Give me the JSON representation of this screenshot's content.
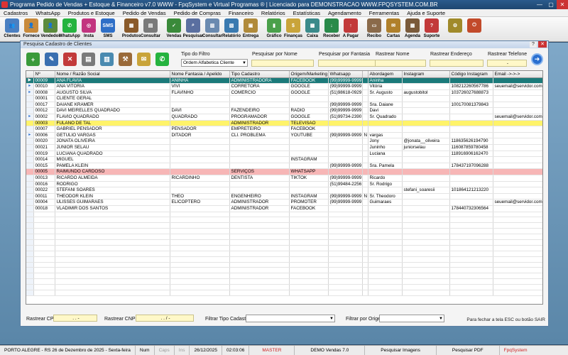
{
  "app": {
    "title": "Programa Pedido de Vendas + Estoque & Financeiro v7.0 WWW - FpqSystem e Virtual Programas ® | Licenciado para  DEMONSTRACAO WWW.FPQSYSTEM.COM.BR",
    "minimize": "—",
    "maximize": "▢",
    "close": "✕"
  },
  "menu": [
    "Cadastros",
    "WhatsApp",
    "Produtos e Estoque",
    "Pedido de Vendas",
    "Pedido de Compras",
    "Financeiro",
    "Relatórios",
    "Estatísticas",
    "Agendamento",
    "Ferramentas",
    "Ajuda e Suporte"
  ],
  "toolbar": [
    {
      "label": "Clientes",
      "icon": "clients-icon",
      "color": "#4a7fc1",
      "glyph": "👥"
    },
    {
      "label": "Fornece",
      "icon": "supplier-icon",
      "color": "#c98a3a",
      "glyph": "👤"
    },
    {
      "label": "Vendedor",
      "icon": "seller-icon",
      "color": "#5b8a3c",
      "glyph": "👤"
    },
    {
      "label": "WhatsApp",
      "icon": "whatsapp-icon",
      "color": "#25b33f",
      "glyph": "✆"
    },
    {
      "label": "Insta",
      "icon": "instagram-icon",
      "color": "#c2357f",
      "glyph": "◎"
    },
    {
      "label": "SMS",
      "icon": "sms-icon",
      "color": "#2f6fc7",
      "glyph": "SMS"
    },
    {
      "label": "Produtos",
      "icon": "products-icon",
      "color": "#8a5a2a",
      "glyph": "▦"
    },
    {
      "label": "Consultar",
      "icon": "consult-icon",
      "color": "#7a7a7a",
      "glyph": "▤"
    },
    {
      "label": "Vendas",
      "icon": "sales-icon",
      "color": "#3a8a3a",
      "glyph": "✓"
    },
    {
      "label": "Pesquisar",
      "icon": "search-icon",
      "color": "#5a6fa0",
      "glyph": "⌕"
    },
    {
      "label": "Consultar",
      "icon": "consult-doc-icon",
      "color": "#6a8ab0",
      "glyph": "▥"
    },
    {
      "label": "Relatório",
      "icon": "report-icon",
      "color": "#3a7ab0",
      "glyph": "▧"
    },
    {
      "label": "Entrega",
      "icon": "delivery-icon",
      "color": "#b08a3a",
      "glyph": "▣"
    },
    {
      "label": "Gráfico",
      "icon": "chart-icon",
      "color": "#4aa04a",
      "glyph": "▮"
    },
    {
      "label": "Finanças",
      "icon": "finance-icon",
      "color": "#c9a43a",
      "glyph": "$"
    },
    {
      "label": "Caixa",
      "icon": "cashbox-icon",
      "color": "#3a8a8a",
      "glyph": "▩"
    },
    {
      "label": "Receber",
      "icon": "receive-icon",
      "color": "#2a8a4a",
      "glyph": "↓"
    },
    {
      "label": "A Pagar",
      "icon": "pay-icon",
      "color": "#c23a3a",
      "glyph": "↑"
    },
    {
      "label": "Recibo",
      "icon": "receipt-icon",
      "color": "#8a6a4a",
      "glyph": "▭"
    },
    {
      "label": "Cartas",
      "icon": "letters-icon",
      "color": "#b0802a",
      "glyph": "✉"
    },
    {
      "label": "Agenda",
      "icon": "calendar-icon",
      "color": "#7a5a3a",
      "glyph": "▦"
    },
    {
      "label": "Suporte",
      "icon": "support-icon",
      "color": "#c23a3a",
      "glyph": "?"
    },
    {
      "label": "",
      "icon": "settings-icon",
      "color": "#a08a2a",
      "glyph": "⚙"
    },
    {
      "label": "",
      "icon": "exit-icon",
      "color": "#c24a2a",
      "glyph": "⏻"
    }
  ],
  "dialog": {
    "title": "Pesquisa Cadastro de Clientes",
    "help": "?",
    "close": "✕",
    "tools": [
      {
        "icon": "add-icon",
        "color": "#3a9a3a",
        "glyph": "+"
      },
      {
        "icon": "edit-icon",
        "color": "#3a6fb0",
        "glyph": "✎"
      },
      {
        "icon": "delete-icon",
        "color": "#c23a3a",
        "glyph": "✕"
      },
      {
        "icon": "print-icon",
        "color": "#7a7a7a",
        "glyph": "▤"
      },
      {
        "icon": "export-icon",
        "color": "#4a8ab0",
        "glyph": "▥"
      },
      {
        "icon": "tools-icon",
        "color": "#9a6a3a",
        "glyph": "⚒"
      },
      {
        "icon": "email-icon",
        "color": "#c9a43a",
        "glyph": "✉"
      },
      {
        "icon": "whatsapp-send-icon",
        "color": "#25b33f",
        "glyph": "✆"
      }
    ],
    "filters": {
      "tipo_filtro_label": "Tipo do Filtro",
      "tipo_filtro_value": "Ordem Alfabetica Cliente",
      "nome_label": "Pesquisar por Nome",
      "fantasia_label": "Pesquisar por Fantasia",
      "rastrear_nome_label": "Rastrear Nome",
      "rastrear_endereco_label": "Rastrear Endereço",
      "rastrear_telefone_label": "Rastrear Telefone",
      "rastrear_telefone_value": "-",
      "go": "➜"
    },
    "columns": [
      "Nº",
      "Nome / Razão Social",
      "Nome Fantasia / Apelido",
      "Tipo Cadastro",
      "Origem/Marketing",
      "Whatsapp",
      "",
      "Abordagem",
      "Instagram",
      "Código Instagram",
      "Email ->->->"
    ],
    "rows": [
      {
        "n": "00009",
        "nome": "ANA FLAVIA",
        "fantasia": "ANINHA",
        "tipo": "ADMINISTRADORA",
        "origem": "FACEBOOK",
        "whats": "(99)99999-9999",
        "f": "",
        "abord": "Aninha",
        "insta": "",
        "cod": "",
        "email": "",
        "style": "sel",
        "ind": "▶"
      },
      {
        "n": "00010",
        "nome": "ANA VITORIA",
        "fantasia": "VIVI",
        "tipo": "CORRETORA",
        "origem": "GOOGLE",
        "whats": "(99)99999-9999",
        "f": "",
        "abord": "Vitória",
        "insta": "",
        "cod": "108212260567786",
        "email": "seuemail@servidor.com.br",
        "style": "",
        "ind": "▸"
      },
      {
        "n": "00008",
        "nome": "AUGUSTO SILVA",
        "fantasia": "FLAVINHO",
        "tipo": "COMERCIO",
        "origem": "GOOGLE",
        "whats": "(51)98618-0929",
        "f": "",
        "abord": "Sr. Augusto",
        "insta": "augustobitol",
        "cod": "103726027688873",
        "email": "",
        "style": "",
        "ind": "▸"
      },
      {
        "n": "00001",
        "nome": "CLIENTE GERAL",
        "fantasia": "",
        "tipo": "",
        "origem": "",
        "whats": "",
        "f": "",
        "abord": "",
        "insta": "",
        "cod": "",
        "email": "",
        "style": "",
        "ind": ""
      },
      {
        "n": "00017",
        "nome": "DAIANE KRAMER",
        "fantasia": "",
        "tipo": "",
        "origem": "",
        "whats": "(99)99999-9999",
        "f": "",
        "abord": "Sra. Daiane",
        "insta": "",
        "cod": "100170081379843",
        "email": "",
        "style": "",
        "ind": ""
      },
      {
        "n": "00012",
        "nome": "DAVI MEIRELLES QUADRADO",
        "fantasia": "DAVI",
        "tipo": "FAZENDEIRO",
        "origem": "RADIO",
        "whats": "(99)99999-9999",
        "f": "",
        "abord": "Davi",
        "insta": "",
        "cod": "",
        "email": "",
        "style": "",
        "ind": ""
      },
      {
        "n": "00002",
        "nome": "FLAVIO QUADRADO",
        "fantasia": "QUADRADO",
        "tipo": "PROGRAMADOR",
        "origem": "GOOGLE",
        "whats": "(51)99734-2390",
        "f": "",
        "abord": "Sr. Quadrado",
        "insta": "",
        "cod": "",
        "email": "seuemail@servidor.com.br",
        "style": "",
        "ind": "▸"
      },
      {
        "n": "00003",
        "nome": "FULANO DE TAL",
        "fantasia": "",
        "tipo": "ADMINISTRADOR",
        "origem": "TELEVISÃO",
        "whats": "",
        "f": "",
        "abord": "",
        "insta": "",
        "cod": "",
        "email": "",
        "style": "yellow",
        "ind": ""
      },
      {
        "n": "00007",
        "nome": "GABRIEL PENSADOR",
        "fantasia": "PENSADOR",
        "tipo": "EMPRETEIRO",
        "origem": "FACEBOOK",
        "whats": "",
        "f": "",
        "abord": "",
        "insta": "",
        "cod": "",
        "email": "",
        "style": "",
        "ind": ""
      },
      {
        "n": "00006",
        "nome": "GETULIO VARGAS",
        "fantasia": "DITADOR",
        "tipo": "CLI. PROBLEMA",
        "origem": "YOUTUBE",
        "whats": "(99)99999-9999",
        "f": "N",
        "abord": "vargas",
        "insta": "",
        "cod": "",
        "email": "",
        "style": "",
        "ind": "▸"
      },
      {
        "n": "00020",
        "nome": "JONATA OLIVEIRA",
        "fantasia": "",
        "tipo": "",
        "origem": "",
        "whats": "",
        "f": "",
        "abord": "Jony",
        "insta": "@jonata__oliveira",
        "cod": "118635626194790",
        "email": "",
        "style": "",
        "ind": ""
      },
      {
        "n": "00021",
        "nome": "JUNIOR SELAU",
        "fantasia": "",
        "tipo": "",
        "origem": "",
        "whats": "",
        "f": "",
        "abord": "Juninho",
        "insta": "juniorselau",
        "cod": "116087859780458",
        "email": "",
        "style": "",
        "ind": ""
      },
      {
        "n": "00019",
        "nome": "LUCIANA QUADRADO",
        "fantasia": "",
        "tipo": "",
        "origem": "",
        "whats": "",
        "f": "",
        "abord": "Luciana",
        "insta": "",
        "cod": "118916906162470",
        "email": "",
        "style": "",
        "ind": ""
      },
      {
        "n": "00014",
        "nome": "MIGUEL",
        "fantasia": "",
        "tipo": "",
        "origem": "INSTAGRAM",
        "whats": "",
        "f": "",
        "abord": "",
        "insta": "",
        "cod": "",
        "email": "",
        "style": "",
        "ind": ""
      },
      {
        "n": "00015",
        "nome": "PAMELA KLEIN",
        "fantasia": "",
        "tipo": "",
        "origem": "",
        "whats": "(99)99999-9999",
        "f": "",
        "abord": "Sra. Pamela",
        "insta": "",
        "cod": "178437197096288",
        "email": "",
        "style": "",
        "ind": ""
      },
      {
        "n": "00005",
        "nome": "RAIMUNDO CARDOSO",
        "fantasia": "",
        "tipo": "SERVIÇOS",
        "origem": "WHATSAPP",
        "whats": "",
        "f": "",
        "abord": "",
        "insta": "",
        "cod": "",
        "email": "",
        "style": "pink",
        "ind": ""
      },
      {
        "n": "00013",
        "nome": "RICARDO ALMEIDA",
        "fantasia": "RICARDINHO",
        "tipo": "DENTISTA",
        "origem": "TIKTOK",
        "whats": "(99)99999-9999",
        "f": "",
        "abord": "Ricardo",
        "insta": "",
        "cod": "",
        "email": "",
        "style": "",
        "ind": ""
      },
      {
        "n": "00016",
        "nome": "RODRIGO",
        "fantasia": "",
        "tipo": "",
        "origem": "",
        "whats": "(51)99484-2256",
        "f": "",
        "abord": "Sr. Rodrigo",
        "insta": "",
        "cod": "",
        "email": "",
        "style": "",
        "ind": ""
      },
      {
        "n": "00022",
        "nome": "STEFANI SOARES",
        "fantasia": "",
        "tipo": "",
        "origem": "",
        "whats": "",
        "f": "",
        "abord": "",
        "insta": "stefani_soaresii",
        "cod": "101864121213220",
        "email": "",
        "style": "",
        "ind": ""
      },
      {
        "n": "00011",
        "nome": "THEODOR KLEIN",
        "fantasia": "THEO",
        "tipo": "ENGENHEIRO",
        "origem": "INSTAGRAM",
        "whats": "(99)99999-9999",
        "f": "N",
        "abord": "Sr. Theodoro",
        "insta": "",
        "cod": "",
        "email": "",
        "style": "",
        "ind": ""
      },
      {
        "n": "00004",
        "nome": "ULISSES GUIMARAES",
        "fantasia": "ELICOPTERO",
        "tipo": "ADMINISTRADOR",
        "origem": "PROMOTER",
        "whats": "(99)99999-9999",
        "f": "",
        "abord": "Guimaraes",
        "insta": "",
        "cod": "",
        "email": "seuemail@servidor.com.br",
        "style": "",
        "ind": ""
      },
      {
        "n": "00018",
        "nome": "VLADIMIR DOS SANTOS",
        "fantasia": "",
        "tipo": "ADMINISTRADOR",
        "origem": "FACEBOOK",
        "whats": "",
        "f": "",
        "abord": "",
        "insta": "",
        "cod": "178440732306564",
        "email": "",
        "style": "",
        "ind": ""
      }
    ],
    "bottom": {
      "cpf_label": "Rastrear CPF",
      "cpf_value": ". . -",
      "cnpj_label": "Rastrear CNPJ",
      "cnpj_value": ". . / -",
      "tipo_cadastro_label": "Filtrar Tipo Cadastro",
      "origem_label": "Filtrar por Origem",
      "note": "Para fechar a tela ESC ou botão SAIR"
    }
  },
  "status": {
    "location_date": "PORTO ALEGRE - RS 26 de Dezembro de 2025 - Sexta-feira",
    "num": "Num",
    "caps": "Caps",
    "ins": "Ins",
    "date": "26/12/2025",
    "time": "02:03:06",
    "user": "MASTER",
    "demo": "DEMO Vendas 7.0",
    "img": "Pesquisar Imagens",
    "pdf": "Pesquisar PDF",
    "brand": "FpqSystem"
  }
}
